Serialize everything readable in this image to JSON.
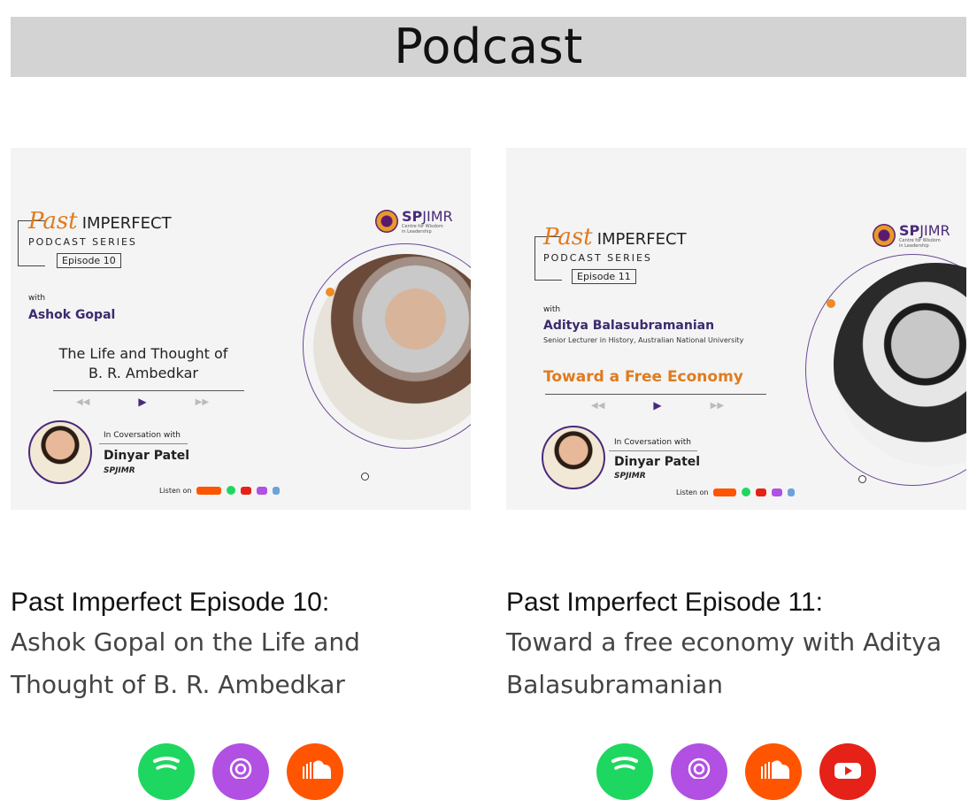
{
  "page": {
    "title": "Podcast"
  },
  "cards": [
    {
      "title": "Past Imperfect Episode 10:",
      "description_line1": "Ashok Gopal on the Life and",
      "description_line2": "Thought of B. R. Ambedkar",
      "thumbnail": {
        "brand_past": "Past",
        "brand_imperfect": "IMPERFECT",
        "series": "PODCAST SERIES",
        "episode": "Episode 10",
        "with": "with",
        "guest": "Ashok Gopal",
        "topic_line1": "The Life and Thought of",
        "topic_line2": "B. R. Ambedkar",
        "conversation": "In Coversation with",
        "host": "Dinyar Patel",
        "host_org": "SPJIMR",
        "listen": "Listen on",
        "logo_sp": "SP",
        "logo_jimr": "JIMR",
        "logo_sub1": "Centre for Wisdom",
        "logo_sub2": "in Leadership"
      },
      "icons": [
        "spotify-icon",
        "apple-podcasts-icon",
        "soundcloud-icon"
      ]
    },
    {
      "title": "Past Imperfect Episode 11:",
      "description_line1": "Toward a free economy with Aditya",
      "description_line2": "Balasubramanian",
      "thumbnail": {
        "brand_past": "Past",
        "brand_imperfect": "IMPERFECT",
        "series": "PODCAST SERIES",
        "episode": "Episode 11",
        "with": "with",
        "guest": "Aditya Balasubramanian",
        "guest_sub": "Senior Lecturer in History, Australian National University",
        "topic_line1": "Toward a Free Economy",
        "conversation": "In Coversation with",
        "host": "Dinyar Patel",
        "host_org": "SPJIMR",
        "listen": "Listen on",
        "logo_sp": "SP",
        "logo_jimr": "JIMR",
        "logo_sub1": "Centre for Wisdom",
        "logo_sub2": "in Leadership"
      },
      "icons": [
        "spotify-icon",
        "apple-podcasts-icon",
        "soundcloud-icon",
        "youtube-icon"
      ]
    }
  ],
  "colors": {
    "spotify": "#1ed760",
    "apple_podcasts": "#b150e2",
    "soundcloud": "#ff5500",
    "youtube": "#e62117",
    "header_bg": "#d3d3d3"
  }
}
